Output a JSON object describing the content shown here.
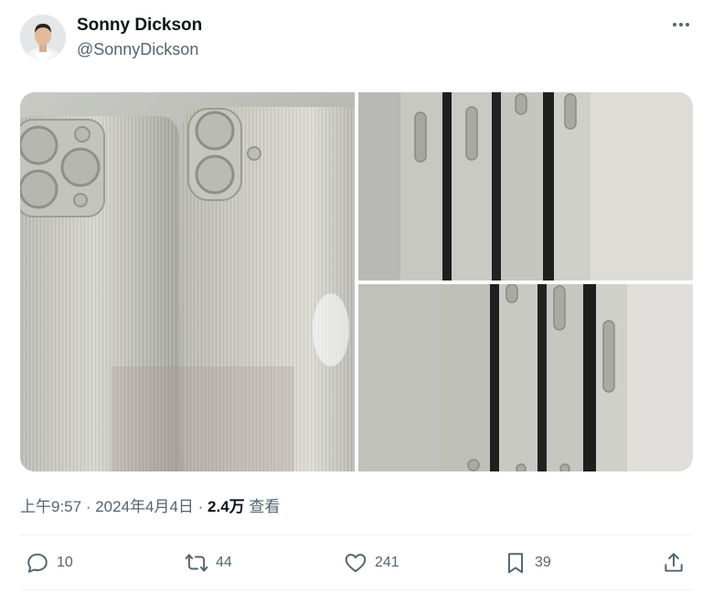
{
  "author": {
    "name": "Sonny Dickson",
    "handle": "@SonnyDickson",
    "avatar_icon": "profile-photo"
  },
  "media": {
    "photos": [
      {
        "name": "photo-phone-backs",
        "icon": "photo"
      },
      {
        "name": "photo-side-buttons-top",
        "icon": "photo"
      },
      {
        "name": "photo-side-buttons-bottom",
        "icon": "photo"
      }
    ]
  },
  "meta": {
    "time": "上午9:57",
    "sep1": " · ",
    "date": "2024年4月4日",
    "sep2": " · ",
    "views_count": "2.4万",
    "views_label": " 查看"
  },
  "actions": {
    "replies": "10",
    "reposts": "44",
    "likes": "241",
    "bookmarks": "39"
  },
  "colors": {
    "text": "#0f1419",
    "secondary": "#536471",
    "divider": "#eff3f4"
  }
}
